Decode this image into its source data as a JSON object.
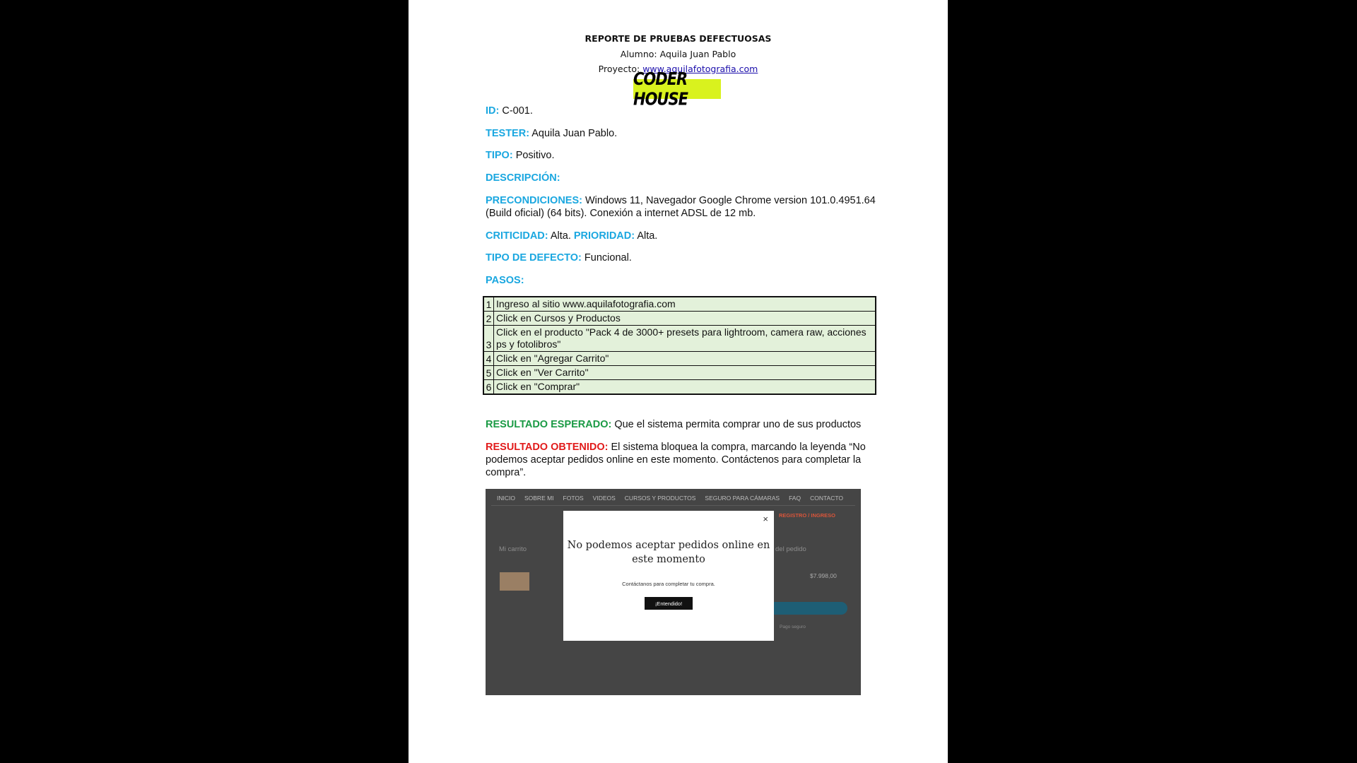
{
  "header": {
    "title": "REPORTE DE PRUEBAS DEFECTUOSAS",
    "student": "Alumno: Aquila Juan Pablo",
    "project_label": "Proyecto: ",
    "project_link": "www.aquilafotografia.com",
    "logo_text": "CODER HOUSE"
  },
  "fields": {
    "id": {
      "label": "ID:",
      "value": " C-001."
    },
    "tester": {
      "label": "TESTER:",
      "value": " Aquila Juan Pablo."
    },
    "tipo": {
      "label": "TIPO:",
      "value": " Positivo."
    },
    "descripcion": {
      "label": "DESCRIPCIÓN:"
    },
    "precondiciones": {
      "label": "PRECONDICIONES:",
      "value": " Windows 11, Navegador Google Chrome version 101.0.4951.64 (Build oficial) (64 bits). Conexión a internet ADSL de 12 mb."
    },
    "criticidad": {
      "label": "CRITICIDAD:",
      "value": " Alta. "
    },
    "prioridad": {
      "label": "PRIORIDAD:",
      "value": " Alta."
    },
    "tipo_defecto": {
      "label": "TIPO DE DEFECTO:",
      "value": " Funcional."
    },
    "pasos": {
      "label": "PASOS:"
    },
    "esperado": {
      "label": "RESULTADO ESPERADO:",
      "value": " Que el sistema permita comprar uno de sus productos"
    },
    "obtenido": {
      "label": "RESULTADO OBTENIDO:",
      "value": " El sistema bloquea la compra, marcando la leyenda “No podemos aceptar pedidos online en este momento. Contáctenos para completar la compra”."
    }
  },
  "steps": [
    {
      "num": "1",
      "text": "Ingreso al sitio www.aquilafotografia.com"
    },
    {
      "num": "2",
      "text": "Click en Cursos y Productos"
    },
    {
      "num": "3",
      "text": "Click en el producto \"Pack 4 de 3000+ presets para lightroom, camera raw, acciones ps y fotolibros\""
    },
    {
      "num": "4",
      "text": "Click en \"Agregar Carrito\""
    },
    {
      "num": "5",
      "text": "Click en \"Ver Carrito\""
    },
    {
      "num": "6",
      "text": "Click en \"Comprar\""
    }
  ],
  "screenshot": {
    "nav": [
      "INICIO",
      "SOBRE MI",
      "FOTOS",
      "VIDEOS",
      "CURSOS Y PRODUCTOS",
      "SEGURO PARA CÁMARAS",
      "FAQ",
      "CONTACTO"
    ],
    "registro": "REGISTRO / INGRESO",
    "cart_title": "Mi carrito",
    "detail_title": "del pedido",
    "price": "$7.998,00",
    "secure_text": "Pago seguro",
    "modal": {
      "close": "×",
      "title": "No podemos aceptar pedidos online en este momento",
      "subtitle": "Contáctanos para completar tu compra.",
      "button": "¡Entendido!"
    }
  }
}
